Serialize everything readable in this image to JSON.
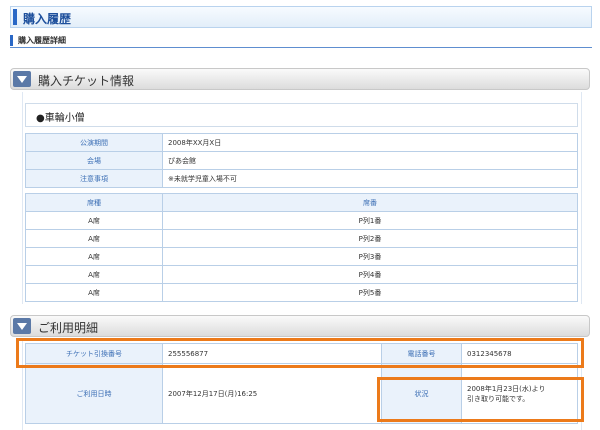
{
  "header": {
    "title": "購入履歴"
  },
  "subheader": {
    "title": "購入履歴詳細"
  },
  "sections": {
    "ticket_info": "購入チケット情報",
    "usage": "ご利用明細"
  },
  "event": {
    "name": "●車輪小僧",
    "details": [
      {
        "label": "公演期間",
        "value": "2008年XX月X日"
      },
      {
        "label": "会場",
        "value": "ぴあ会館"
      },
      {
        "label": "注意事項",
        "value": "※未就学児童入場不可"
      }
    ]
  },
  "seats": {
    "headers": [
      "席種",
      "席番"
    ],
    "rows": [
      [
        "A席",
        "P列1番"
      ],
      [
        "A席",
        "P列2番"
      ],
      [
        "A席",
        "P列3番"
      ],
      [
        "A席",
        "P列4番"
      ],
      [
        "A席",
        "P列5番"
      ]
    ]
  },
  "usage": {
    "ticket_no_label": "チケット引換番号",
    "ticket_no": "255556877",
    "phone_label": "電話番号",
    "phone": "0312345678",
    "date_label": "ご利用日時",
    "date": "2007年12月17日(月)16:25",
    "status_label": "状況",
    "status_line1": "2008年1月23日(水)より",
    "status_line2": "引き取り可能です。"
  },
  "colors": {
    "accent": "#2a68c6",
    "highlight": "#ec7a1a",
    "label_bg": "#eaf2fb"
  }
}
